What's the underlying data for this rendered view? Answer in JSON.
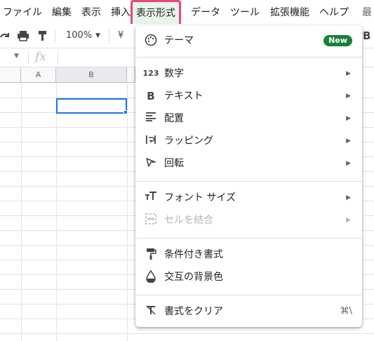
{
  "menubar": {
    "items": [
      "ファイル",
      "編集",
      "表示",
      "挿入",
      "表示形式",
      "データ",
      "ツール",
      "拡張機能",
      "ヘルプ",
      "最"
    ]
  },
  "toolbar": {
    "zoom": "100%",
    "currency": "¥",
    "right_bold": "B"
  },
  "formula_bar": {
    "fx": "fx"
  },
  "grid": {
    "columns": [
      "A",
      "B"
    ]
  },
  "format_menu": {
    "theme": {
      "label": "テーマ",
      "badge": "New"
    },
    "items1": [
      {
        "label": "数字",
        "icon": "number-format-icon"
      },
      {
        "label": "テキスト",
        "icon": "bold-icon"
      },
      {
        "label": "配置",
        "icon": "align-icon"
      },
      {
        "label": "ラッピング",
        "icon": "wrap-icon"
      },
      {
        "label": "回転",
        "icon": "rotate-icon"
      }
    ],
    "items2": [
      {
        "label": "フォント サイズ",
        "icon": "font-size-icon"
      },
      {
        "label": "セルを結合",
        "icon": "merge-cells-icon",
        "disabled": true
      }
    ],
    "items3": [
      {
        "label": "条件付き書式",
        "icon": "paint-roller-icon"
      },
      {
        "label": "交互の背景色",
        "icon": "fill-drop-icon"
      }
    ],
    "clear": {
      "label": "書式をクリア",
      "shortcut": "⌘\\"
    },
    "icon_text": {
      "number": "123",
      "bold": "B"
    }
  },
  "colors": {
    "accent": "#1a73e8",
    "badge": "#188038",
    "highlight_border": "#e8467c",
    "highlight_bg": "#e6f4ea"
  }
}
